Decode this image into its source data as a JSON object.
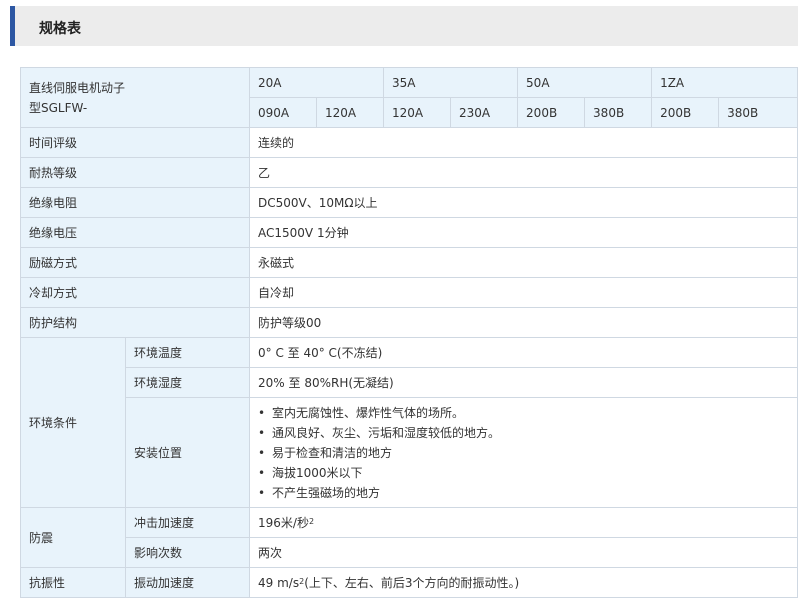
{
  "header": {
    "title": "规格表"
  },
  "table": {
    "model_label_line1": "直线伺服电机动子",
    "model_label_line2": "型SGLFW-",
    "groups": [
      "20A",
      "35A",
      "50A",
      "1ZA"
    ],
    "subs": [
      "090A",
      "120A",
      "120A",
      "230A",
      "200B",
      "380B",
      "200B",
      "380B"
    ],
    "rows": {
      "time_rating": {
        "label": "时间评级",
        "value": "连续的"
      },
      "heat_class": {
        "label": "耐热等级",
        "value": "乙"
      },
      "insulation_resistance": {
        "label": "绝缘电阻",
        "value": "DC500V、10MΩ以上"
      },
      "insulation_voltage": {
        "label": "绝缘电压",
        "value": "AC1500V 1分钟"
      },
      "excitation": {
        "label": "励磁方式",
        "value": "永磁式"
      },
      "cooling": {
        "label": "冷却方式",
        "value": "自冷却"
      },
      "protection": {
        "label": "防护结构",
        "value": "防护等级00"
      }
    },
    "env": {
      "label": "环境条件",
      "temp_label": "环境温度",
      "temp_value": "0° C 至 40° C(不冻结)",
      "humidity_label": "环境湿度",
      "humidity_value": "20% 至 80%RH(无凝结)",
      "install_label": "安装位置",
      "bullet": "•",
      "install_items": [
        "室内无腐蚀性、爆炸性气体的场所。",
        "通风良好、灰尘、污垢和湿度较低的地方。",
        "易于检查和清洁的地方",
        "海拔1000米以下",
        "不产生强磁场的地方"
      ]
    },
    "shock": {
      "label": "防震",
      "accel_label": "冲击加速度",
      "accel_value": "196米/秒",
      "accel_sup": "2",
      "count_label": "影响次数",
      "count_value": "两次"
    },
    "vibration": {
      "label": "抗振性",
      "accel_label": "振动加速度",
      "accel_value_pre": "49 m/s",
      "accel_sup": "2",
      "accel_value_post": "(上下、左右、前后3个方向的耐振动性。)"
    }
  }
}
